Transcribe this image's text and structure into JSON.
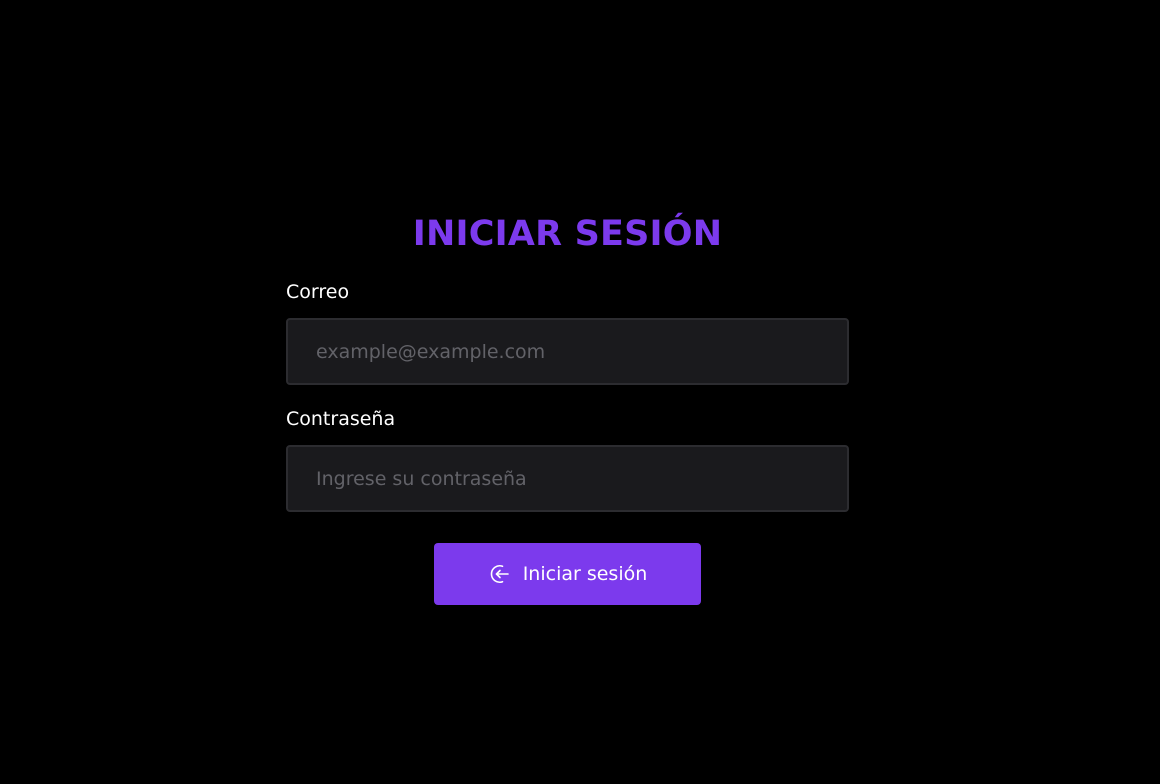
{
  "login": {
    "title": "INICIAR SESIÓN",
    "email": {
      "label": "Correo",
      "placeholder": "example@example.com",
      "value": ""
    },
    "password": {
      "label": "Contraseña",
      "placeholder": "Ingrese su contraseña",
      "value": ""
    },
    "submit": {
      "label": "Iniciar sesión",
      "icon": "login-icon"
    }
  },
  "colors": {
    "background": "#000000",
    "accent": "#7c3aed",
    "input_background": "#1a1a1d",
    "input_border": "#2c2c30",
    "placeholder": "#626268",
    "text": "#ffffff"
  }
}
